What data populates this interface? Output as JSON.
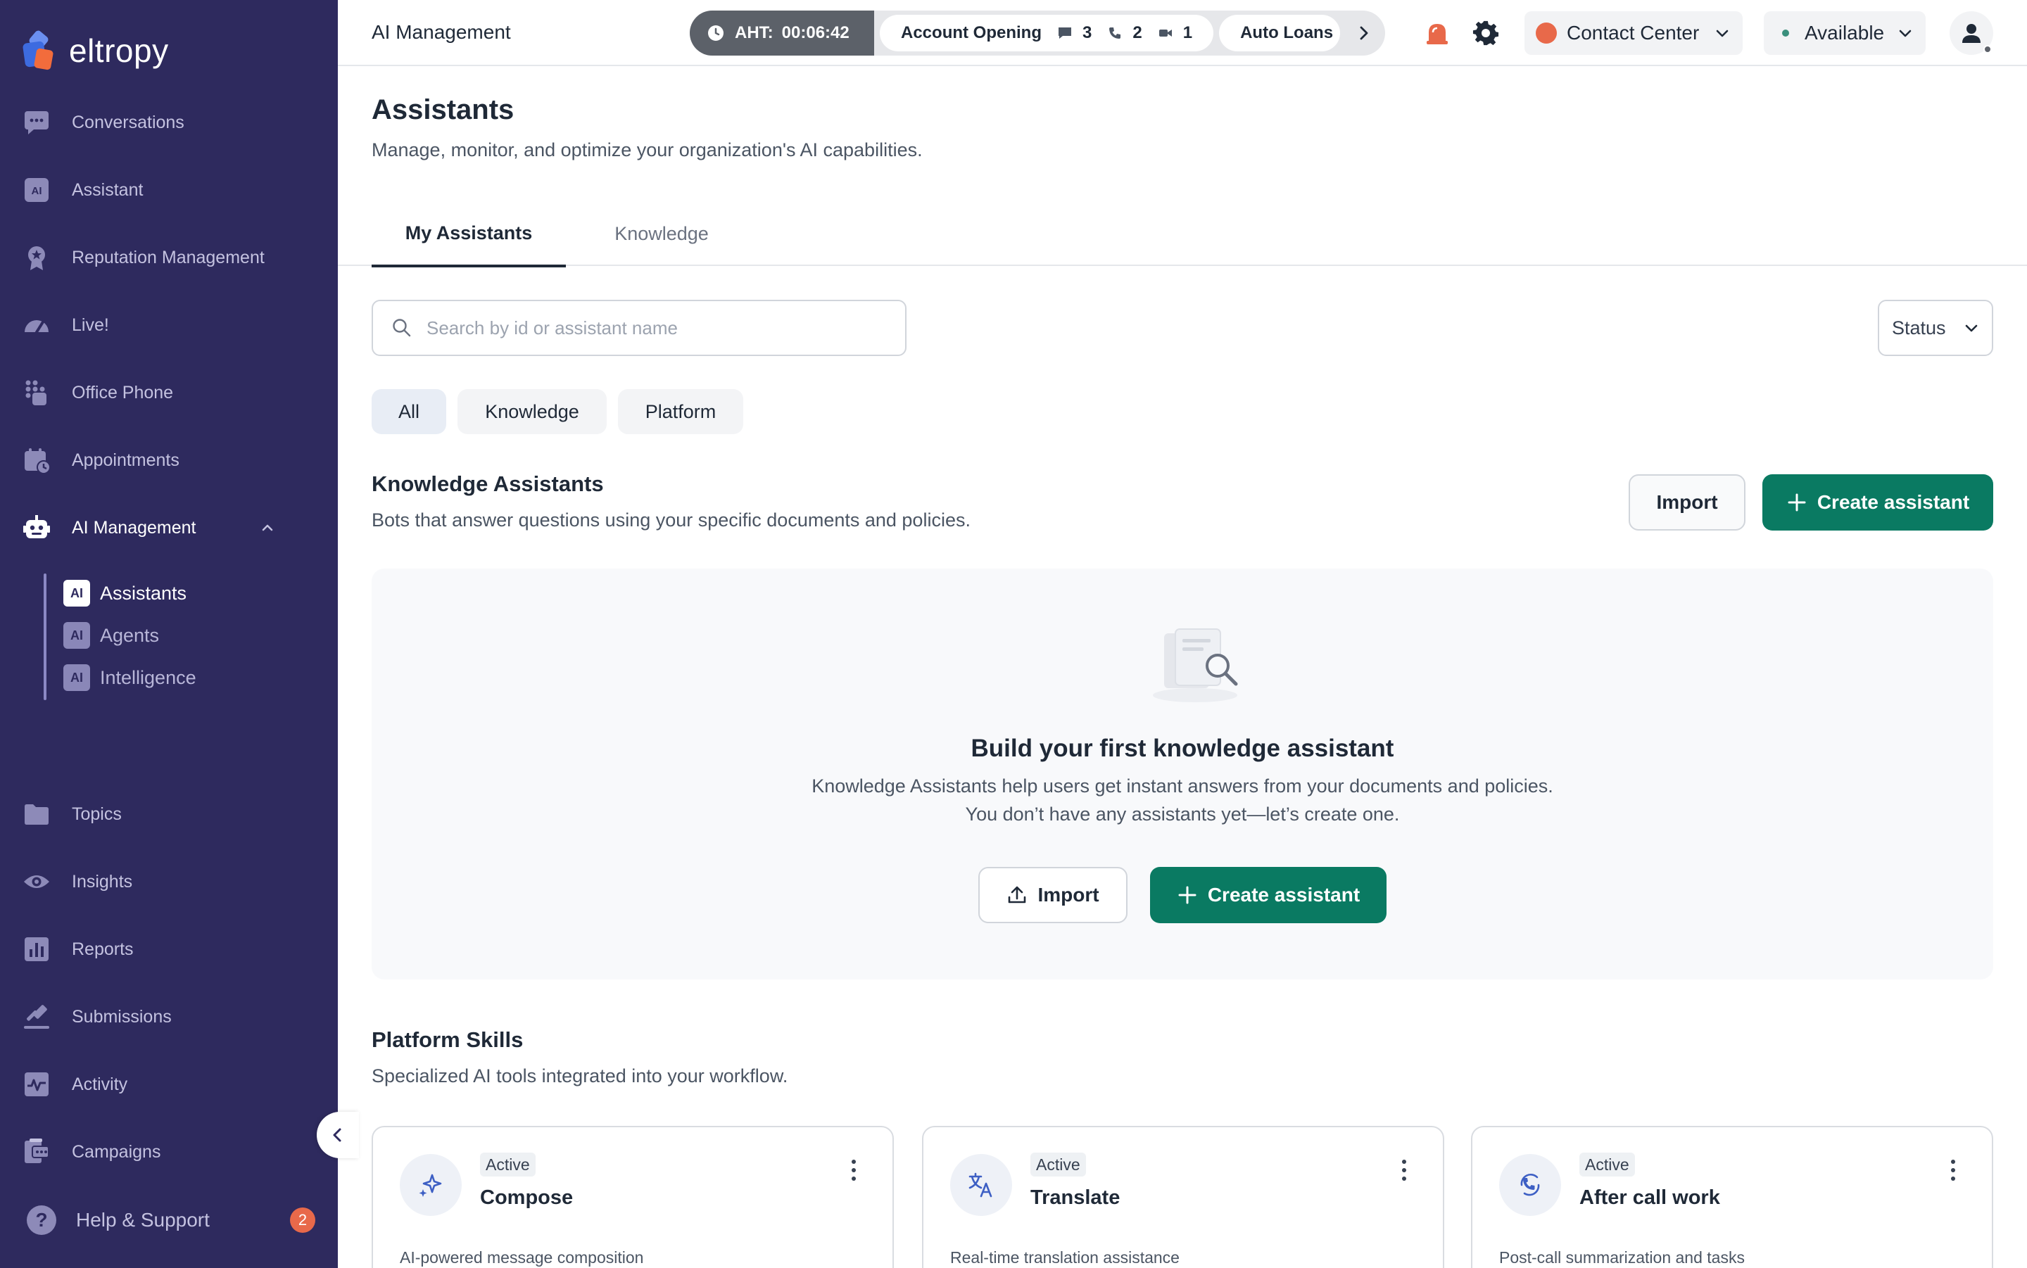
{
  "brand": {
    "name": "eltropy"
  },
  "sidebar": {
    "items": [
      {
        "label": "Conversations",
        "icon": "chat-icon"
      },
      {
        "label": "Assistant",
        "icon": "ai-icon"
      },
      {
        "label": "Reputation Management",
        "icon": "badge-icon"
      },
      {
        "label": "Live!",
        "icon": "gauge-icon"
      },
      {
        "label": "Office Phone",
        "icon": "keypad-icon"
      },
      {
        "label": "Appointments",
        "icon": "calendar-icon"
      },
      {
        "label": "AI Management",
        "icon": "robot-icon"
      },
      {
        "label": "Topics",
        "icon": "folder-icon"
      },
      {
        "label": "Insights",
        "icon": "eye-icon"
      },
      {
        "label": "Reports",
        "icon": "bar-chart-icon"
      },
      {
        "label": "Submissions",
        "icon": "gavel-icon"
      },
      {
        "label": "Activity",
        "icon": "pulse-icon"
      },
      {
        "label": "Campaigns",
        "icon": "campaign-icon"
      }
    ],
    "sub_items": [
      {
        "chip": "AI",
        "label": "Assistants"
      },
      {
        "chip": "AI",
        "label": "Agents"
      },
      {
        "chip": "AI",
        "label": "Intelligence"
      }
    ],
    "help": {
      "label": "Help & Support",
      "badge": "2"
    }
  },
  "topbar": {
    "title": "AI Management",
    "aht": {
      "label": "AHT:",
      "value": "00:06:42"
    },
    "queue": {
      "name": "Account Opening",
      "chats": "3",
      "calls": "2",
      "videos": "1"
    },
    "queue2": {
      "name": "Auto Loans"
    },
    "context": "Contact Center",
    "status": "Available",
    "colors": {
      "accent": "#0a7a62",
      "sidebar": "#2e2a5e",
      "alert": "#e8694a"
    }
  },
  "page": {
    "title": "Assistants",
    "subtitle": "Manage, monitor, and optimize your organization's AI capabilities.",
    "tabs": [
      "My Assistants",
      "Knowledge"
    ],
    "search_placeholder": "Search by id or assistant name",
    "status_filter": "Status",
    "chips": [
      "All",
      "Knowledge",
      "Platform"
    ]
  },
  "knowledge": {
    "title": "Knowledge Assistants",
    "subtitle": "Bots that answer questions using your specific documents and policies.",
    "import_label": "Import",
    "create_label": "Create assistant",
    "empty": {
      "title": "Build your first knowledge assistant",
      "line1": "Knowledge Assistants help users get instant answers from your documents and policies.",
      "line2": "You don’t have any assistants yet—let’s create one.",
      "import_label": "Import",
      "create_label": "Create assistant"
    }
  },
  "platform": {
    "title": "Platform Skills",
    "subtitle": "Specialized AI tools integrated into your workflow.",
    "skills": [
      {
        "name": "Compose",
        "status": "Active",
        "description": "AI-powered message composition",
        "icon": "sparkle-icon"
      },
      {
        "name": "Translate",
        "status": "Active",
        "description": "Real-time translation assistance",
        "icon": "translate-icon"
      },
      {
        "name": "After call work",
        "status": "Active",
        "description": "Post-call summarization and tasks",
        "icon": "phone-sync-icon"
      }
    ]
  }
}
